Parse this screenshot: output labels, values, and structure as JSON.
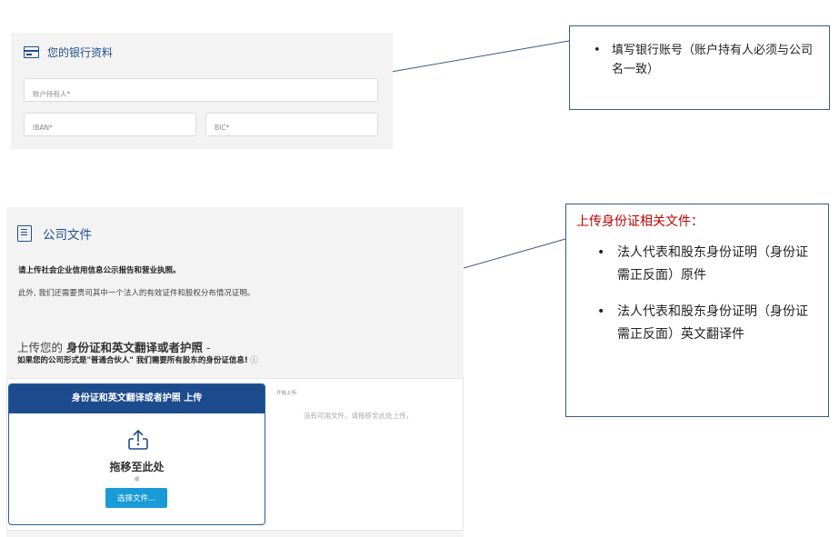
{
  "bank": {
    "title": "您的银行资料",
    "holder_placeholder": "账户持有人*",
    "iban_placeholder": "IBAN*",
    "bic_placeholder": "BIC*"
  },
  "note1": {
    "items": [
      "填写银行账号（账户持有人必须与公司名一致）"
    ]
  },
  "docs": {
    "title": "公司文件",
    "line1": "请上传社会企业信用信息公示报告和营业执照。",
    "line2": "此外, 我们还需要贵司其中一个法人的有效证件和股权分布情况证明。",
    "upload_heading_prefix": "上传您的 ",
    "upload_heading_bold": "身份证和英文翻译或者护照",
    "upload_heading_suffix": " -",
    "upload_sub": "如果您的公司形式是\"普通合伙人\" 我们需要所有股东的身份证信息!",
    "upload_sub_info": " ⓘ"
  },
  "upload": {
    "header": "身份证和英文翻译或者护照 上传",
    "drop_text": "拖移至此处",
    "or_text": "或",
    "choose_button": "选择文件...",
    "started_label": "开始上传:",
    "no_files": "没有可用文件。请拖移至此处上传。"
  },
  "note2": {
    "title": "上传身份证相关文件：",
    "items": [
      "法人代表和股东身份证明（身份证需正反面）原件",
      "法人代表和股东身份证明（身份证需正反面）英文翻译件"
    ]
  },
  "colors": {
    "brand_blue": "#1d4c8e",
    "button_blue": "#1a9bd7",
    "note_title_red": "#c00000"
  },
  "icons": [
    "credit-card-icon",
    "document-icon",
    "upload-icon"
  ]
}
